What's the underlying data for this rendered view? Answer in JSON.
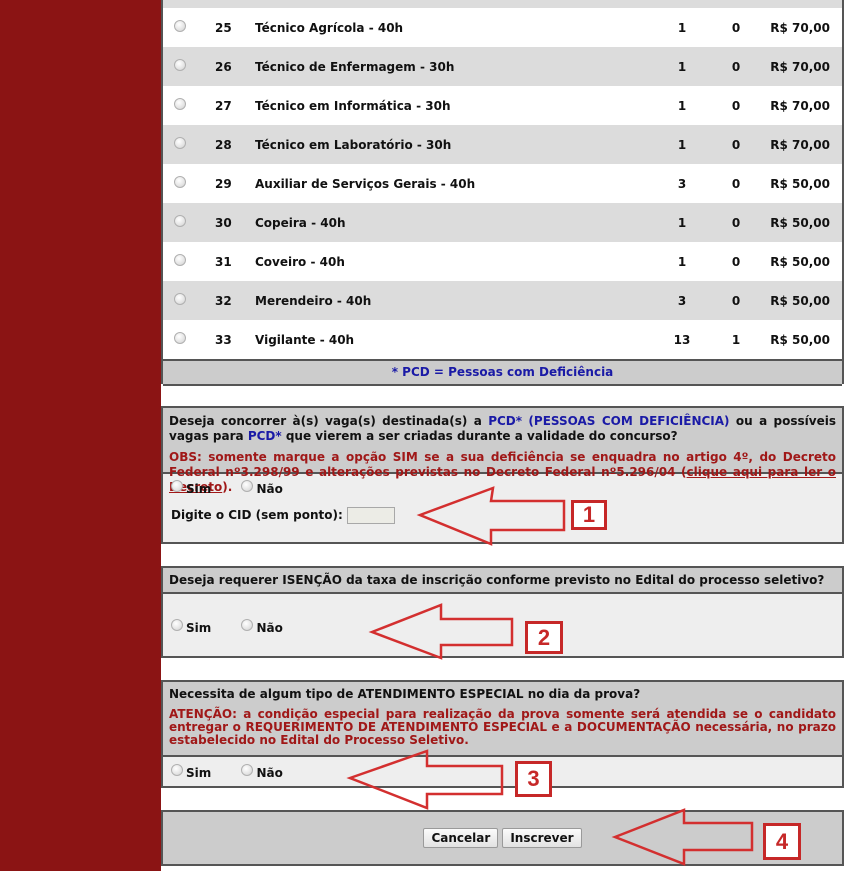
{
  "colors": {
    "sidebar": "#8b1414",
    "accent_blue": "#1a1aa6",
    "warning_red": "#a01818",
    "annotation_red": "#c62828"
  },
  "jobs_table": {
    "rows": [
      {
        "num": "25",
        "name": "Técnico Agrícola - 40h",
        "vagas": "1",
        "pcd": "0",
        "fee": "R$ 70,00"
      },
      {
        "num": "26",
        "name": "Técnico de Enfermagem - 30h",
        "vagas": "1",
        "pcd": "0",
        "fee": "R$ 70,00"
      },
      {
        "num": "27",
        "name": "Técnico em Informática - 30h",
        "vagas": "1",
        "pcd": "0",
        "fee": "R$ 70,00"
      },
      {
        "num": "28",
        "name": "Técnico em Laboratório - 30h",
        "vagas": "1",
        "pcd": "0",
        "fee": "R$ 70,00"
      },
      {
        "num": "29",
        "name": "Auxiliar de Serviços Gerais - 40h",
        "vagas": "3",
        "pcd": "0",
        "fee": "R$ 50,00"
      },
      {
        "num": "30",
        "name": "Copeira - 40h",
        "vagas": "1",
        "pcd": "0",
        "fee": "R$ 50,00"
      },
      {
        "num": "31",
        "name": "Coveiro - 40h",
        "vagas": "1",
        "pcd": "0",
        "fee": "R$ 50,00"
      },
      {
        "num": "32",
        "name": "Merendeiro - 40h",
        "vagas": "3",
        "pcd": "0",
        "fee": "R$ 50,00"
      },
      {
        "num": "33",
        "name": "Vigilante - 40h",
        "vagas": "13",
        "pcd": "1",
        "fee": "R$ 50,00"
      }
    ],
    "footnote": "* PCD = Pessoas com Deficiência"
  },
  "pcd_section": {
    "q_part1": "Deseja concorrer à(s) vaga(s) destinada(s) a ",
    "q_pcd1": "PCD* (PESSOAS COM DEFICIÊNCIA)",
    "q_part2": " ou a possíveis vagas para ",
    "q_pcd2": "PCD*",
    "q_part3": " que vierem a ser criadas durante a validade do concurso?",
    "obs_text": "OBS: somente marque a opção SIM se a sua deficiência se enquadra no artigo 4º, do Decreto Federal nº3.298/99 e alterações previstas no Decreto Federal nº5.296/04 (",
    "obs_link": "clique aqui para ler o Decreto",
    "obs_end": ").",
    "option_yes": "Sim",
    "option_no": "Não",
    "cid_label": "Digite o CID (sem ponto):",
    "cid_value": ""
  },
  "exemption_section": {
    "question": "Deseja requerer ISENÇÃO da taxa de inscrição conforme previsto no Edital do processo seletivo?",
    "option_yes": "Sim",
    "option_no": "Não"
  },
  "special_section": {
    "question": "Necessita de algum tipo de ATENDIMENTO ESPECIAL no dia da prova?",
    "warning": "ATENÇÃO: a condição especial para realização da prova somente será atendida se o candidato entregar o REQUERIMENTO DE ATENDIMENTO ESPECIAL e a DOCUMENTAÇÃO necessária, no prazo estabelecido no Edital do Processo Seletivo.",
    "option_yes": "Sim",
    "option_no": "Não"
  },
  "actions": {
    "cancel_label": "Cancelar",
    "submit_label": "Inscrever"
  },
  "annotations": [
    "1",
    "2",
    "3",
    "4"
  ]
}
